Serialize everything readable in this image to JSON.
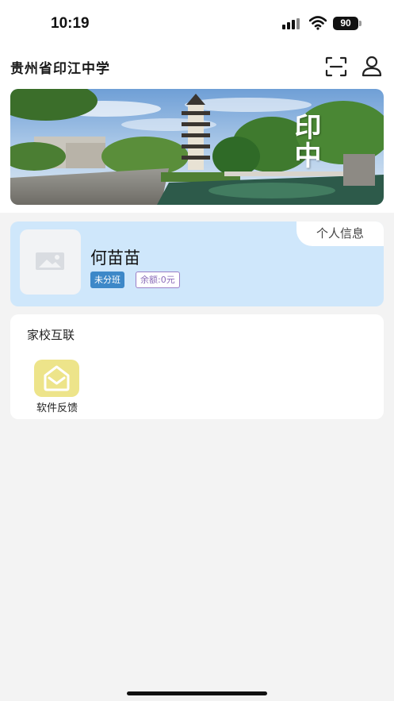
{
  "status_bar": {
    "time": "10:19",
    "battery": "90",
    "icons": [
      "signal-icon",
      "wifi-icon",
      "battery-icon"
    ]
  },
  "header": {
    "title": "贵州省印江中学",
    "icons": [
      "scan-icon",
      "user-icon"
    ]
  },
  "banner": {
    "caption": "印中"
  },
  "profile": {
    "tab_label": "个人信息",
    "name": "何苗苗",
    "class_badge": "未分班",
    "balance_badge": "余额:0元",
    "avatar_icon": "image-placeholder-icon"
  },
  "services": {
    "section_title": "家校互联",
    "items": [
      {
        "label": "软件反馈",
        "icon": "mail-icon",
        "color": "#ede48a"
      }
    ]
  },
  "colors": {
    "profile_card": "#cfe7fb",
    "class_badge": "#3d88c8",
    "balance_badge_border": "#9b7fc6",
    "page_background": "#f3f3f3"
  }
}
